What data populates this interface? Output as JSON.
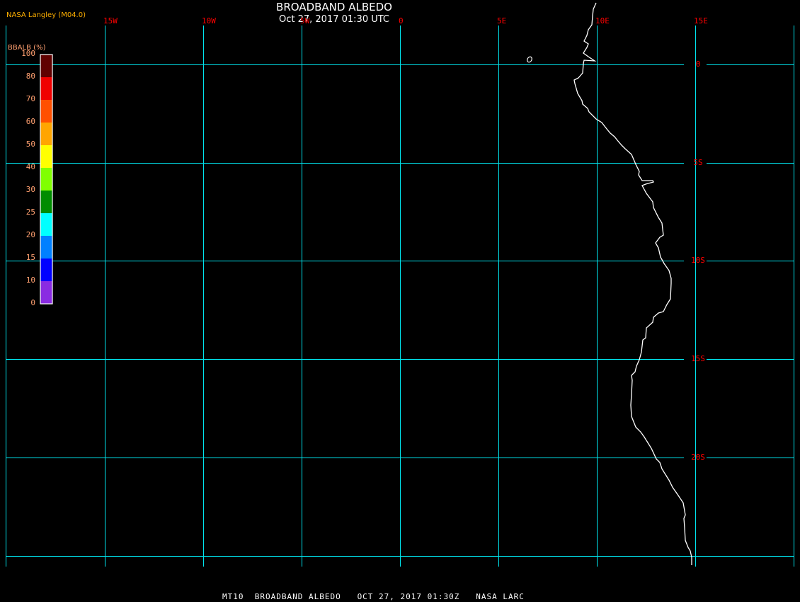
{
  "header": {
    "title": "BROADBAND ALBEDO",
    "subtitle": "Oct 27, 2017 01:30 UTC",
    "credit": "NASA Langley (M04.0)"
  },
  "footer": "MT10  BROADBAND ALBEDO   OCT 27, 2017 01:30Z   NASA LARC",
  "map": {
    "grid_color": "#00e5ee",
    "coastline_color": "#ffffff",
    "longitude_labels": [
      "15W",
      "10W",
      "5W",
      "0",
      "5E",
      "10E",
      "15E"
    ],
    "latitude_labels": [
      "0",
      "5S",
      "10S",
      "15S",
      "20S"
    ]
  },
  "legend": {
    "title": "BBALB (%)",
    "tick_labels": [
      "100",
      "80",
      "70",
      "60",
      "50",
      "40",
      "30",
      "25",
      "20",
      "15",
      "10",
      "0"
    ],
    "colors": [
      "#600000",
      "#f00000",
      "#ff5000",
      "#ffa500",
      "#ffff00",
      "#80ff00",
      "#008c00",
      "#00ffff",
      "#0080ff",
      "#0000ff",
      "#8a2be2"
    ]
  }
}
